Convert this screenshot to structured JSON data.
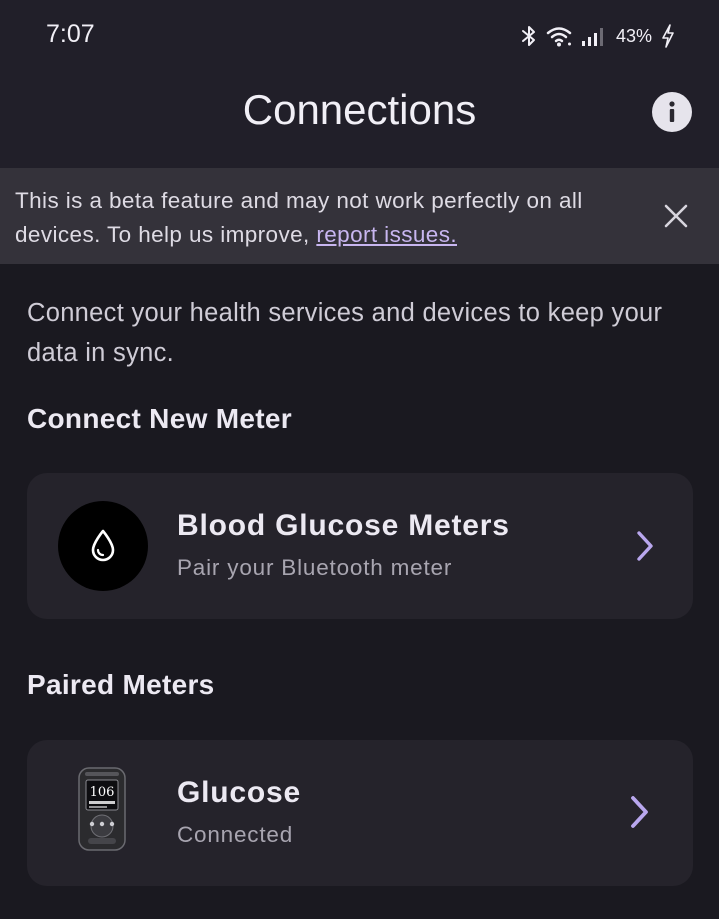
{
  "status_bar": {
    "time": "7:07",
    "battery_percent": "43%"
  },
  "header": {
    "title": "Connections"
  },
  "banner": {
    "text": "This is a beta feature and may not work perfectly on all devices. To help us improve, ",
    "link_text": "report issues."
  },
  "intro": "Connect your health services and devices to keep your data in sync.",
  "connect_new": {
    "heading": "Connect New Meter",
    "item": {
      "title": "Blood Glucose Meters",
      "subtitle": "Pair your Bluetooth meter",
      "icon": "blood-drop-icon"
    }
  },
  "paired": {
    "heading": "Paired Meters",
    "item": {
      "title": "Glucose",
      "subtitle": "Connected",
      "icon": "glucose-meter-icon",
      "display_value": "106"
    }
  },
  "colors": {
    "accent": "#b9a7ee",
    "background": "#1a1920",
    "card": "#25232b",
    "banner": "#34323a"
  }
}
